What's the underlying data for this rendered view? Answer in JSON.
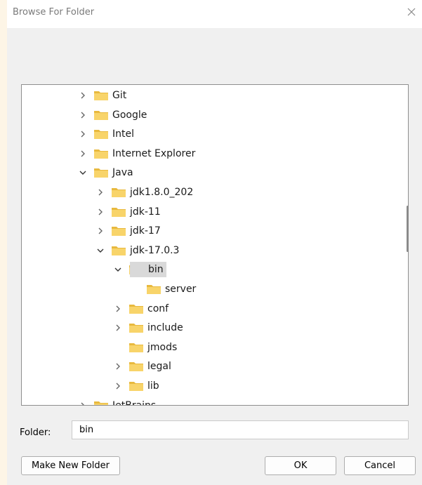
{
  "dialog": {
    "title": "Browse For Folder",
    "close_icon": "close-icon"
  },
  "tree": {
    "items": [
      {
        "label": "Git",
        "depth": 0,
        "expander": "collapsed"
      },
      {
        "label": "Google",
        "depth": 0,
        "expander": "collapsed"
      },
      {
        "label": "Intel",
        "depth": 0,
        "expander": "collapsed"
      },
      {
        "label": "Internet Explorer",
        "depth": 0,
        "expander": "collapsed"
      },
      {
        "label": "Java",
        "depth": 0,
        "expander": "expanded"
      },
      {
        "label": "jdk1.8.0_202",
        "depth": 1,
        "expander": "collapsed"
      },
      {
        "label": "jdk-11",
        "depth": 1,
        "expander": "collapsed"
      },
      {
        "label": "jdk-17",
        "depth": 1,
        "expander": "collapsed"
      },
      {
        "label": "jdk-17.0.3",
        "depth": 1,
        "expander": "expanded"
      },
      {
        "label": "bin",
        "depth": 2,
        "expander": "expanded",
        "selected": true
      },
      {
        "label": "server",
        "depth": 3,
        "expander": "none"
      },
      {
        "label": "conf",
        "depth": 2,
        "expander": "collapsed"
      },
      {
        "label": "include",
        "depth": 2,
        "expander": "collapsed"
      },
      {
        "label": "jmods",
        "depth": 2,
        "expander": "none"
      },
      {
        "label": "legal",
        "depth": 2,
        "expander": "collapsed"
      },
      {
        "label": "lib",
        "depth": 2,
        "expander": "collapsed"
      },
      {
        "label": "JetBrains",
        "depth": 0,
        "expander": "collapsed"
      }
    ],
    "folder_color": "#f8d46a",
    "selected_color": "#d9d9d9"
  },
  "folder_field": {
    "label": "Folder:",
    "value": "bin"
  },
  "buttons": {
    "make_new_folder": "Make New Folder",
    "ok": "OK",
    "cancel": "Cancel"
  }
}
